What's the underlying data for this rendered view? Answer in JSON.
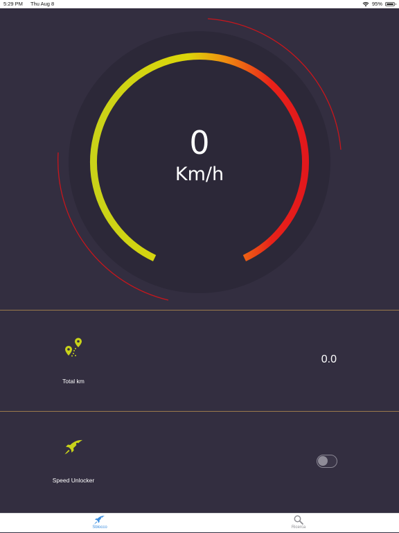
{
  "status_bar": {
    "time": "5:29 PM",
    "date": "Thu Aug 8",
    "battery": "95%",
    "battery_level": 0.95
  },
  "gauge": {
    "speed": "0",
    "unit": "Km/h"
  },
  "stats": {
    "total_km_label": "Total km",
    "total_km_value": "0.0"
  },
  "unlocker": {
    "label": "Speed Unlocker",
    "enabled": false
  },
  "tabs": [
    {
      "label": "Sblocco",
      "icon": "rocket-icon",
      "active": true
    },
    {
      "label": "Ricerca",
      "icon": "search-icon",
      "active": false
    }
  ],
  "colors": {
    "background": "#332e40",
    "accent_lime": "#c8d21a",
    "accent_red": "#e0161c",
    "tab_active": "#3d8fe0",
    "tab_inactive": "#8e8e93",
    "divider": "#9b7a4c"
  }
}
